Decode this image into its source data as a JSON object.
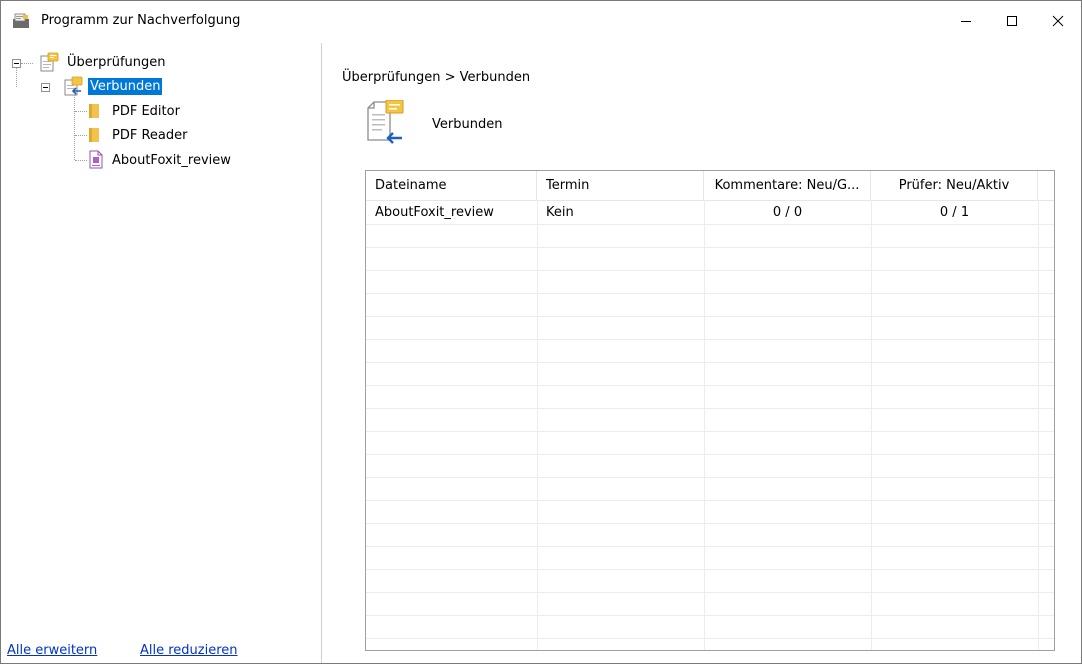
{
  "window": {
    "title": "Programm zur Nachverfolgung",
    "icons": {
      "app": "tracker-app-icon",
      "minimize": "minimize-icon",
      "maximize": "maximize-icon",
      "close": "close-icon"
    }
  },
  "tree": {
    "root": {
      "label": "Überprüfungen",
      "icon": "reviews-icon"
    },
    "selected": {
      "label": "Verbunden",
      "icon": "shared-review-icon"
    },
    "children": [
      {
        "label": "PDF Editor",
        "icon": "folder-icon"
      },
      {
        "label": "PDF Reader",
        "icon": "folder-icon"
      },
      {
        "label": "AboutFoxit_review",
        "icon": "pdf-file-icon"
      }
    ]
  },
  "links": {
    "expand_all": "Alle erweitern",
    "collapse_all": "Alle reduzieren"
  },
  "main": {
    "breadcrumb": "Überprüfungen > Verbunden",
    "header_title": "Verbunden",
    "header_icon": "shared-review-icon"
  },
  "table": {
    "columns": [
      "Dateiname",
      "Termin",
      "Kommentare: Neu/G...",
      "Prüfer: Neu/Aktiv"
    ],
    "rows": [
      {
        "filename": "AboutFoxit_review",
        "deadline": "Kein",
        "comments": "0 / 0",
        "reviewers": "0 / 1"
      }
    ]
  },
  "colors": {
    "selection": "#0078d7",
    "link": "#0033cc",
    "grid": "#ececec"
  }
}
